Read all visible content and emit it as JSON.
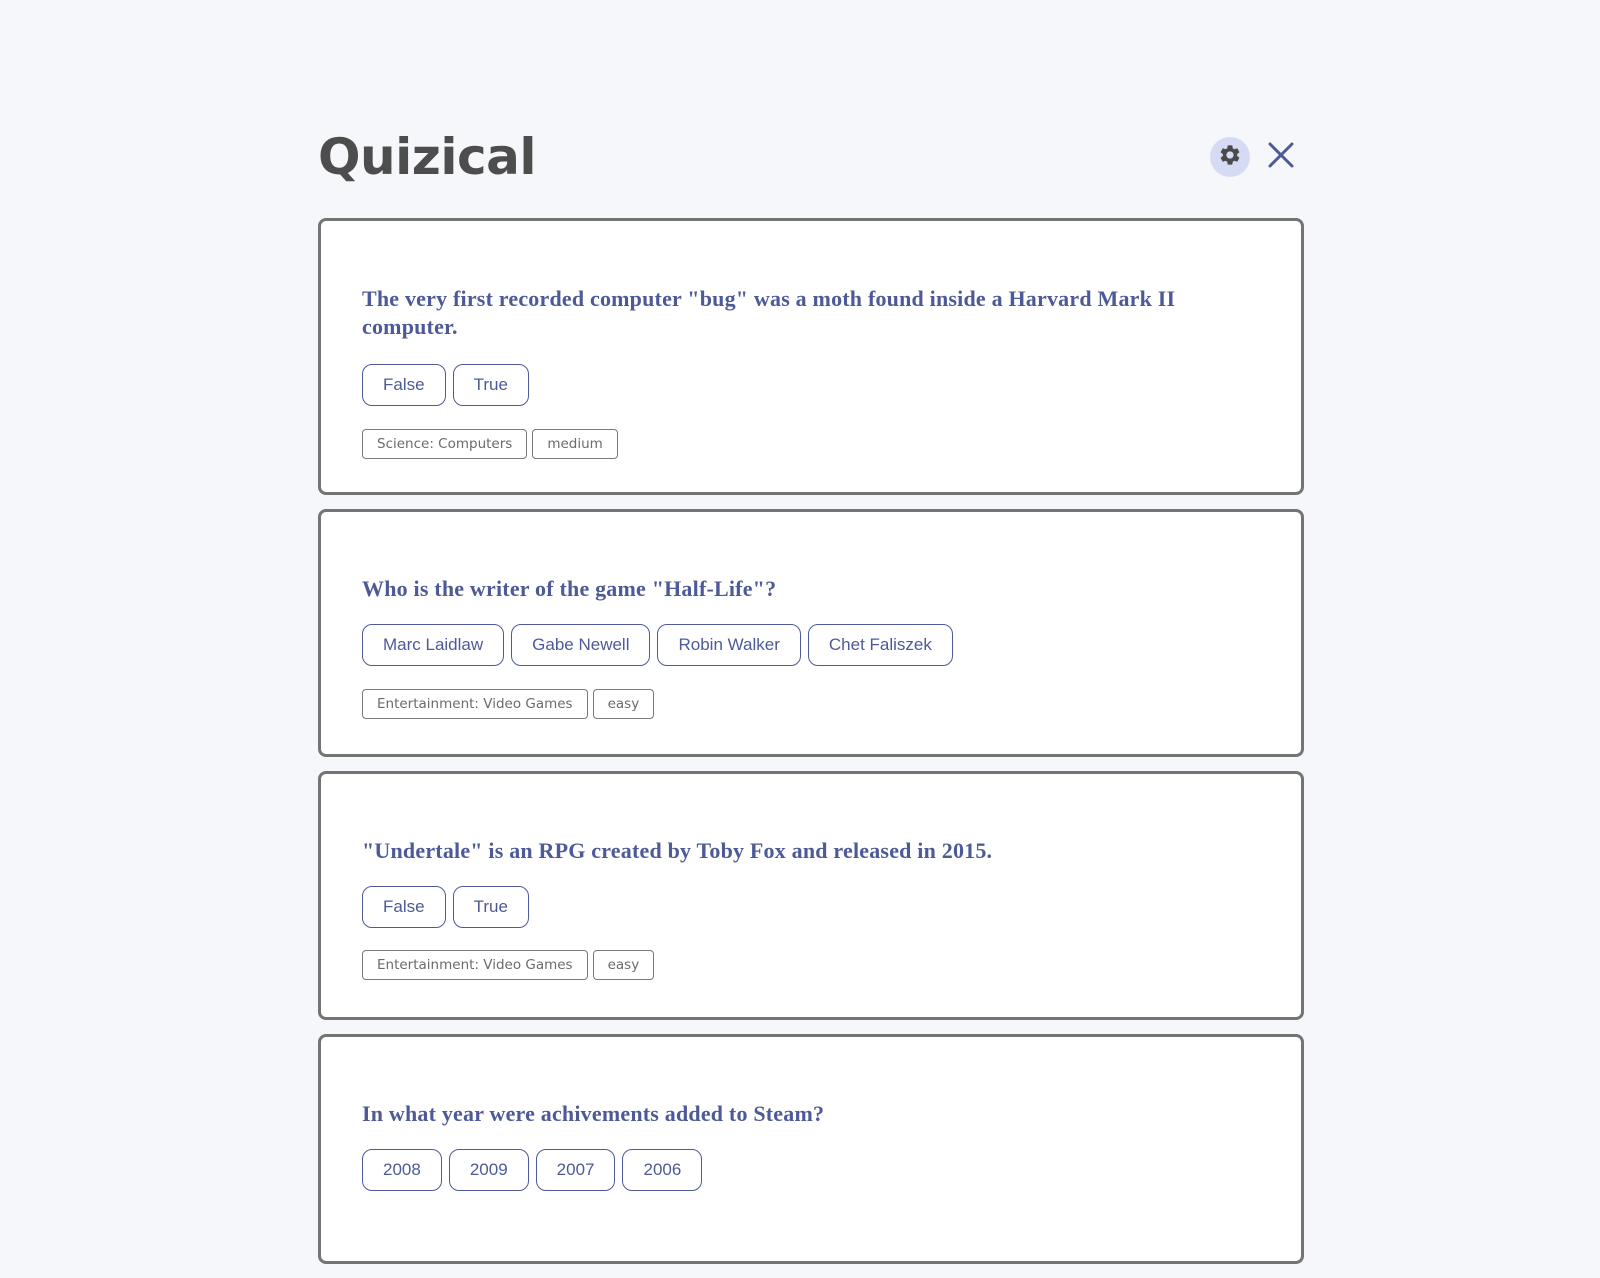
{
  "app": {
    "title": "Quizical"
  },
  "header": {
    "settings_icon": "gear-icon",
    "close_icon": "close-icon",
    "icon_color": "#4e5a98",
    "settings_bg": "#d6dbf5"
  },
  "questions": [
    {
      "text": "The very first recorded computer \"bug\" was a moth found inside a Harvard Mark II computer.",
      "answers": [
        "False",
        "True"
      ],
      "category": "Science: Computers",
      "difficulty": "medium"
    },
    {
      "text": "Who is the writer of the game \"Half-Life\"?",
      "answers": [
        "Marc Laidlaw",
        "Gabe Newell",
        "Robin Walker",
        "Chet Faliszek"
      ],
      "category": "Entertainment: Video Games",
      "difficulty": "easy"
    },
    {
      "text": "\"Undertale\" is an RPG created by Toby Fox and released in 2015.",
      "answers": [
        "False",
        "True"
      ],
      "category": "Entertainment: Video Games",
      "difficulty": "easy"
    },
    {
      "text": "In what year were achivements added to Steam?",
      "answers": [
        "2008",
        "2009",
        "2007",
        "2006"
      ]
    }
  ],
  "colors": {
    "accent": "#4e5a98",
    "background": "#f5f7fb",
    "card_border": "#747474",
    "title": "#4d4d4d"
  }
}
